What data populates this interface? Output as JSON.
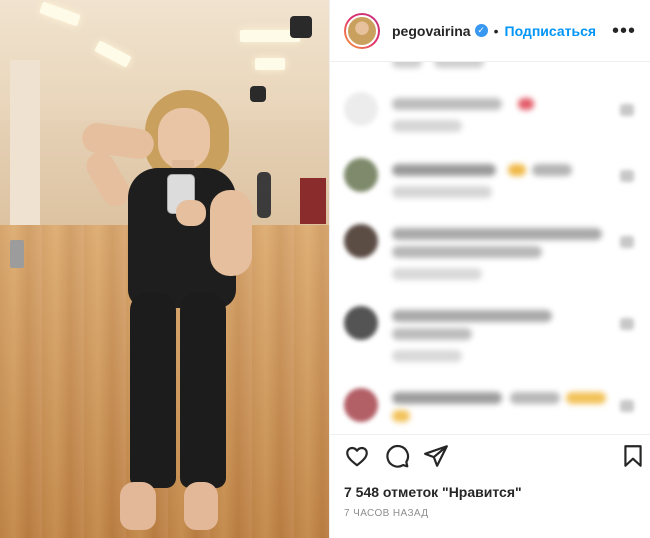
{
  "header": {
    "username": "pegovairina",
    "separator": "•",
    "follow_label": "Подписаться",
    "more_label": "•••"
  },
  "icons": {
    "verified": "verified-badge-icon",
    "like": "heart-icon",
    "comment": "comment-icon",
    "share": "paper-plane-icon",
    "save": "bookmark-icon",
    "more": "more-options-icon"
  },
  "colors": {
    "accent": "#0095f6",
    "text": "#262626",
    "muted": "#8e8e8e"
  },
  "post": {
    "likes_text": "7 548 отметок \"Нравится\"",
    "time_text": "7 часов назад"
  }
}
